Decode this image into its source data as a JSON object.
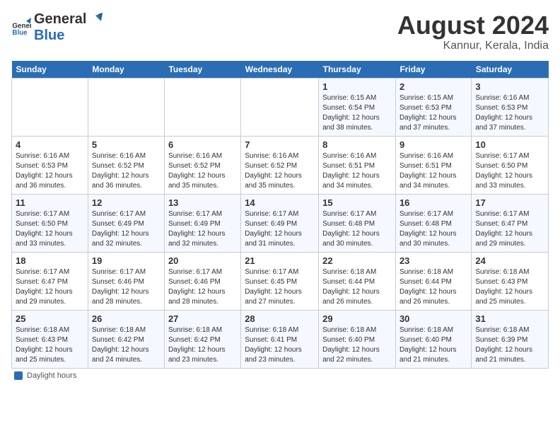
{
  "header": {
    "logo_general": "General",
    "logo_blue": "Blue",
    "title": "August 2024",
    "subtitle": "Kannur, Kerala, India"
  },
  "footer": {
    "label": "Daylight hours"
  },
  "days_of_week": [
    "Sunday",
    "Monday",
    "Tuesday",
    "Wednesday",
    "Thursday",
    "Friday",
    "Saturday"
  ],
  "weeks": [
    {
      "days": [
        {
          "num": "",
          "info": ""
        },
        {
          "num": "",
          "info": ""
        },
        {
          "num": "",
          "info": ""
        },
        {
          "num": "",
          "info": ""
        },
        {
          "num": "1",
          "info": "Sunrise: 6:15 AM\nSunset: 6:54 PM\nDaylight: 12 hours\nand 38 minutes."
        },
        {
          "num": "2",
          "info": "Sunrise: 6:15 AM\nSunset: 6:53 PM\nDaylight: 12 hours\nand 37 minutes."
        },
        {
          "num": "3",
          "info": "Sunrise: 6:16 AM\nSunset: 6:53 PM\nDaylight: 12 hours\nand 37 minutes."
        }
      ]
    },
    {
      "days": [
        {
          "num": "4",
          "info": "Sunrise: 6:16 AM\nSunset: 6:53 PM\nDaylight: 12 hours\nand 36 minutes."
        },
        {
          "num": "5",
          "info": "Sunrise: 6:16 AM\nSunset: 6:52 PM\nDaylight: 12 hours\nand 36 minutes."
        },
        {
          "num": "6",
          "info": "Sunrise: 6:16 AM\nSunset: 6:52 PM\nDaylight: 12 hours\nand 35 minutes."
        },
        {
          "num": "7",
          "info": "Sunrise: 6:16 AM\nSunset: 6:52 PM\nDaylight: 12 hours\nand 35 minutes."
        },
        {
          "num": "8",
          "info": "Sunrise: 6:16 AM\nSunset: 6:51 PM\nDaylight: 12 hours\nand 34 minutes."
        },
        {
          "num": "9",
          "info": "Sunrise: 6:16 AM\nSunset: 6:51 PM\nDaylight: 12 hours\nand 34 minutes."
        },
        {
          "num": "10",
          "info": "Sunrise: 6:17 AM\nSunset: 6:50 PM\nDaylight: 12 hours\nand 33 minutes."
        }
      ]
    },
    {
      "days": [
        {
          "num": "11",
          "info": "Sunrise: 6:17 AM\nSunset: 6:50 PM\nDaylight: 12 hours\nand 33 minutes."
        },
        {
          "num": "12",
          "info": "Sunrise: 6:17 AM\nSunset: 6:49 PM\nDaylight: 12 hours\nand 32 minutes."
        },
        {
          "num": "13",
          "info": "Sunrise: 6:17 AM\nSunset: 6:49 PM\nDaylight: 12 hours\nand 32 minutes."
        },
        {
          "num": "14",
          "info": "Sunrise: 6:17 AM\nSunset: 6:49 PM\nDaylight: 12 hours\nand 31 minutes."
        },
        {
          "num": "15",
          "info": "Sunrise: 6:17 AM\nSunset: 6:48 PM\nDaylight: 12 hours\nand 30 minutes."
        },
        {
          "num": "16",
          "info": "Sunrise: 6:17 AM\nSunset: 6:48 PM\nDaylight: 12 hours\nand 30 minutes."
        },
        {
          "num": "17",
          "info": "Sunrise: 6:17 AM\nSunset: 6:47 PM\nDaylight: 12 hours\nand 29 minutes."
        }
      ]
    },
    {
      "days": [
        {
          "num": "18",
          "info": "Sunrise: 6:17 AM\nSunset: 6:47 PM\nDaylight: 12 hours\nand 29 minutes."
        },
        {
          "num": "19",
          "info": "Sunrise: 6:17 AM\nSunset: 6:46 PM\nDaylight: 12 hours\nand 28 minutes."
        },
        {
          "num": "20",
          "info": "Sunrise: 6:17 AM\nSunset: 6:46 PM\nDaylight: 12 hours\nand 28 minutes."
        },
        {
          "num": "21",
          "info": "Sunrise: 6:17 AM\nSunset: 6:45 PM\nDaylight: 12 hours\nand 27 minutes."
        },
        {
          "num": "22",
          "info": "Sunrise: 6:18 AM\nSunset: 6:44 PM\nDaylight: 12 hours\nand 26 minutes."
        },
        {
          "num": "23",
          "info": "Sunrise: 6:18 AM\nSunset: 6:44 PM\nDaylight: 12 hours\nand 26 minutes."
        },
        {
          "num": "24",
          "info": "Sunrise: 6:18 AM\nSunset: 6:43 PM\nDaylight: 12 hours\nand 25 minutes."
        }
      ]
    },
    {
      "days": [
        {
          "num": "25",
          "info": "Sunrise: 6:18 AM\nSunset: 6:43 PM\nDaylight: 12 hours\nand 25 minutes."
        },
        {
          "num": "26",
          "info": "Sunrise: 6:18 AM\nSunset: 6:42 PM\nDaylight: 12 hours\nand 24 minutes."
        },
        {
          "num": "27",
          "info": "Sunrise: 6:18 AM\nSunset: 6:42 PM\nDaylight: 12 hours\nand 23 minutes."
        },
        {
          "num": "28",
          "info": "Sunrise: 6:18 AM\nSunset: 6:41 PM\nDaylight: 12 hours\nand 23 minutes."
        },
        {
          "num": "29",
          "info": "Sunrise: 6:18 AM\nSunset: 6:40 PM\nDaylight: 12 hours\nand 22 minutes."
        },
        {
          "num": "30",
          "info": "Sunrise: 6:18 AM\nSunset: 6:40 PM\nDaylight: 12 hours\nand 21 minutes."
        },
        {
          "num": "31",
          "info": "Sunrise: 6:18 AM\nSunset: 6:39 PM\nDaylight: 12 hours\nand 21 minutes."
        }
      ]
    }
  ]
}
